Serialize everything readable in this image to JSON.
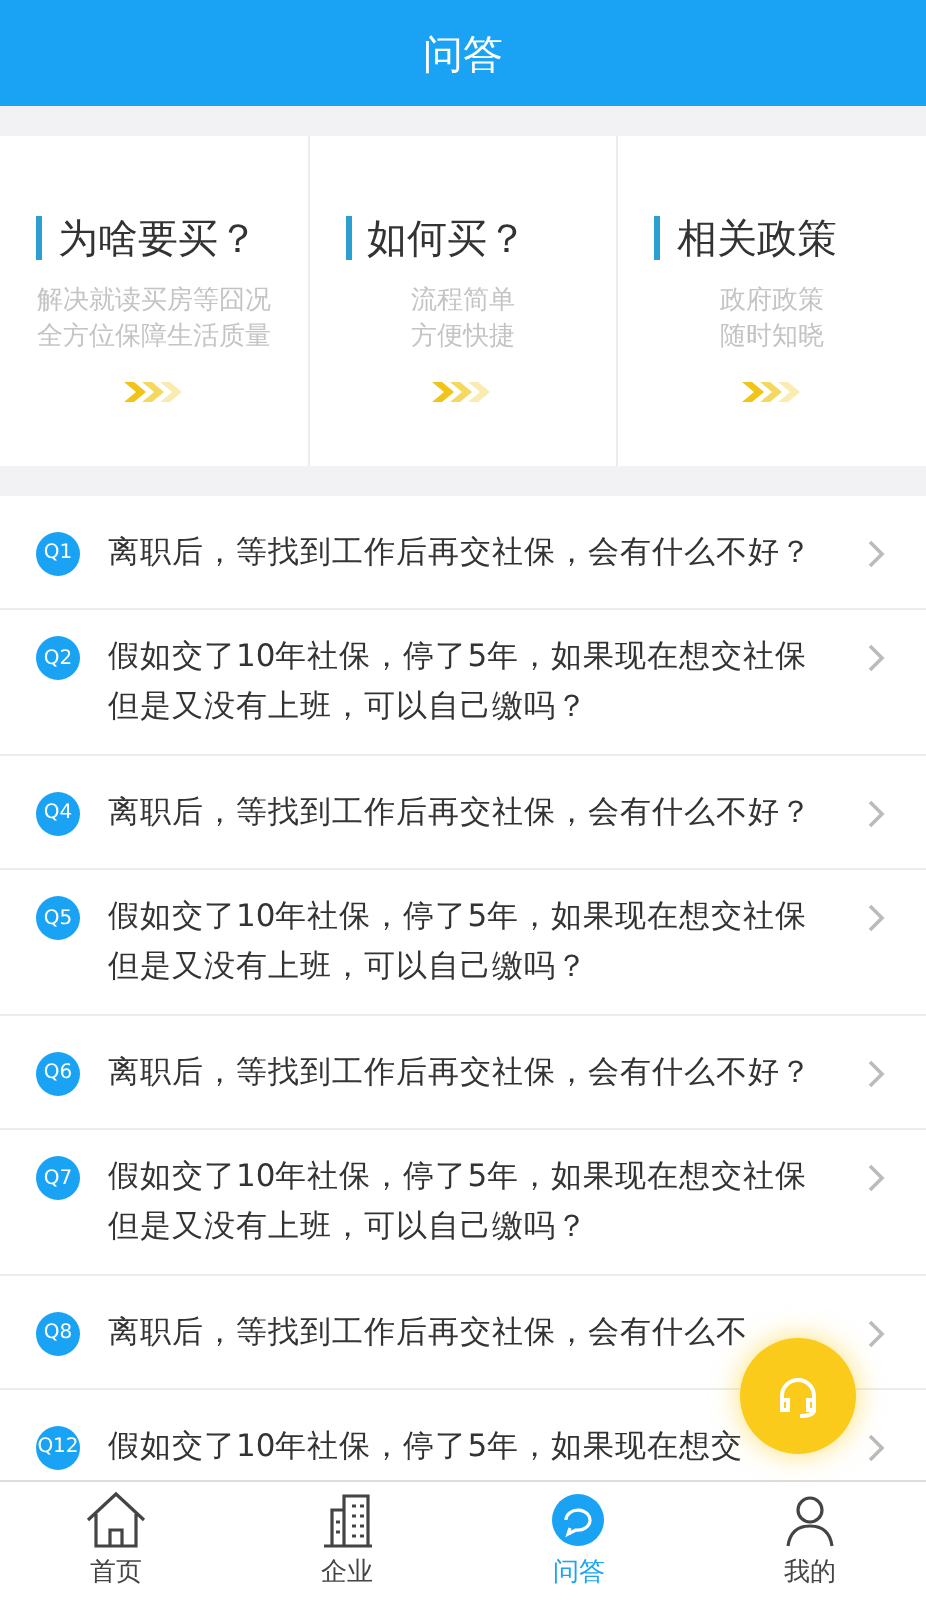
{
  "header": {
    "title": "问答"
  },
  "cards": [
    {
      "title": "为啥要买？",
      "lines": [
        "解决就读买房等囧况",
        "全方位保障生活质量"
      ]
    },
    {
      "title": "如何买？",
      "lines": [
        "流程简单",
        "方便快捷"
      ]
    },
    {
      "title": "相关政策",
      "lines": [
        "政府政策",
        "随时知晓"
      ]
    }
  ],
  "questions": [
    {
      "badge": "Q1",
      "text": "离职后，等找到工作后再交社保，会有什么不好？"
    },
    {
      "badge": "Q2",
      "text": "假如交了10年社保，停了5年，如果现在想交社保但是又没有上班，可以自己缴吗？"
    },
    {
      "badge": "Q4",
      "text": "离职后，等找到工作后再交社保，会有什么不好？"
    },
    {
      "badge": "Q5",
      "text": "假如交了10年社保，停了5年，如果现在想交社保但是又没有上班，可以自己缴吗？"
    },
    {
      "badge": "Q6",
      "text": "离职后，等找到工作后再交社保，会有什么不好？"
    },
    {
      "badge": "Q7",
      "text": "假如交了10年社保，停了5年，如果现在想交社保但是又没有上班，可以自己缴吗？"
    },
    {
      "badge": "Q8",
      "text": "离职后，等找到工作后再交社保，会有什么不"
    },
    {
      "badge": "Q12",
      "text": "假如交了10年社保，停了5年，如果现在想交"
    }
  ],
  "tabs": [
    {
      "label": "首页",
      "kind": "home",
      "selected": false
    },
    {
      "label": "企业",
      "kind": "building",
      "selected": false
    },
    {
      "label": "问答",
      "kind": "qa",
      "selected": true
    },
    {
      "label": "我的",
      "kind": "user",
      "selected": false
    }
  ]
}
